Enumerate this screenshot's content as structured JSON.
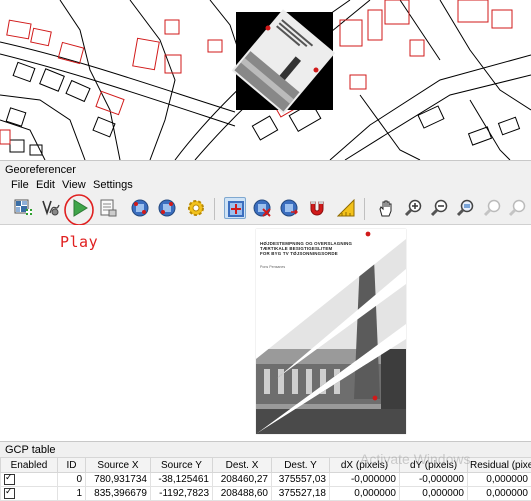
{
  "window": {
    "title": "Georeferencer"
  },
  "menu": [
    "File",
    "Edit",
    "View",
    "Settings"
  ],
  "toolbar": {
    "buttons": [
      {
        "name": "open-raster-icon"
      },
      {
        "name": "transformation-settings-icon"
      },
      {
        "name": "start-georeferencing-icon"
      },
      {
        "name": "generate-gdal-script-icon"
      },
      {
        "name": "load-gcp-points-icon"
      },
      {
        "name": "save-gcp-points-icon"
      },
      {
        "name": "settings-gear-icon"
      },
      {
        "name": "add-point-icon"
      },
      {
        "name": "delete-point-icon"
      },
      {
        "name": "move-gcp-icon"
      },
      {
        "name": "link-georeferencer-icon"
      },
      {
        "name": "link-qgis-icon"
      },
      {
        "name": "pan-icon"
      },
      {
        "name": "zoom-in-icon"
      },
      {
        "name": "zoom-out-icon"
      },
      {
        "name": "zoom-to-layer-icon"
      },
      {
        "name": "zoom-last-icon"
      },
      {
        "name": "zoom-next-icon"
      }
    ]
  },
  "annotation": {
    "text": "Play",
    "color": "#e02020"
  },
  "raster_doc": {
    "title_lines": [
      "HØJDESTEMPNING OG OVERSLAGNING",
      "TÆRTIKALE BESIGTIGESLITEM",
      "FOR BYG    TV TØJSONNINGSORDE"
    ],
    "author": "Pons Pensanes"
  },
  "gcp": {
    "title": "GCP table",
    "columns": [
      "Enabled",
      "ID",
      "Source X",
      "Source Y",
      "Dest. X",
      "Dest. Y",
      "dX (pixels)",
      "dY (pixels)",
      "Residual (pixels)"
    ],
    "rows": [
      {
        "enabled": true,
        "id": "0",
        "source_x": "780,931734",
        "source_y": "-38,125461",
        "dest_x": "208460,27",
        "dest_y": "375557,03",
        "dx": "-0,000000",
        "dy": "-0,000000",
        "residual": "0,000000"
      },
      {
        "enabled": true,
        "id": "1",
        "source_x": "835,396679",
        "source_y": "-1192,7823",
        "dest_x": "208488,60",
        "dest_y": "375527,18",
        "dx": "0,000000",
        "dy": "0,000000",
        "residual": "0,000000"
      }
    ]
  },
  "watermark": "Activate Windows",
  "colors": {
    "accent_red": "#e02020",
    "map_outline_red": "#d11a1a",
    "toolbar_active": "#cfe3f6"
  }
}
